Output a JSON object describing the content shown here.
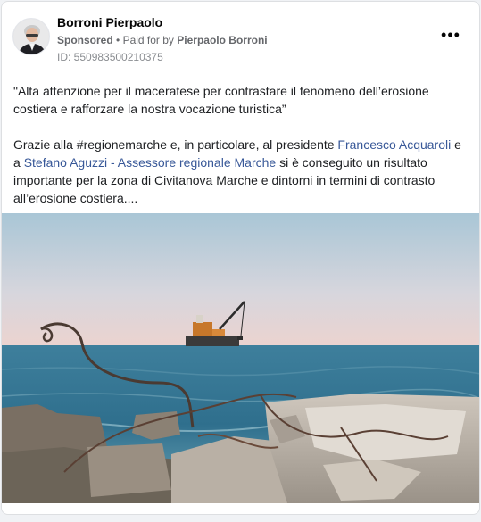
{
  "post": {
    "author": "Borroni Pierpaolo",
    "sponsored_label": "Sponsored",
    "separator": "•",
    "paid_for_label": "Paid for by",
    "payer": "Pierpaolo Borroni",
    "ad_id": "ID: 550983500210375",
    "more_glyph": "•••",
    "quote": "\"Alta attenzione per il maceratese per contrastare il fenomeno dell’erosione costiera e rafforzare la nostra vocazione turistica”",
    "line_prefix": "Grazie alla #regionemarche e, in particolare, al presidente ",
    "mention_1": "Francesco Acquaroli",
    "line_mid": " e a ",
    "mention_2": "Stefano Aguzzi - Assessore regionale Marche",
    "line_suffix": " si è conseguito un risultato importante per la zona di Civitanova Marche e dintorni in termini di contrasto all’erosione costiera...."
  },
  "colors": {
    "link": "#385898",
    "secondary_text": "#65676b"
  },
  "image": {
    "subject": "sea-with-crane-barge-and-rubble-photo"
  }
}
